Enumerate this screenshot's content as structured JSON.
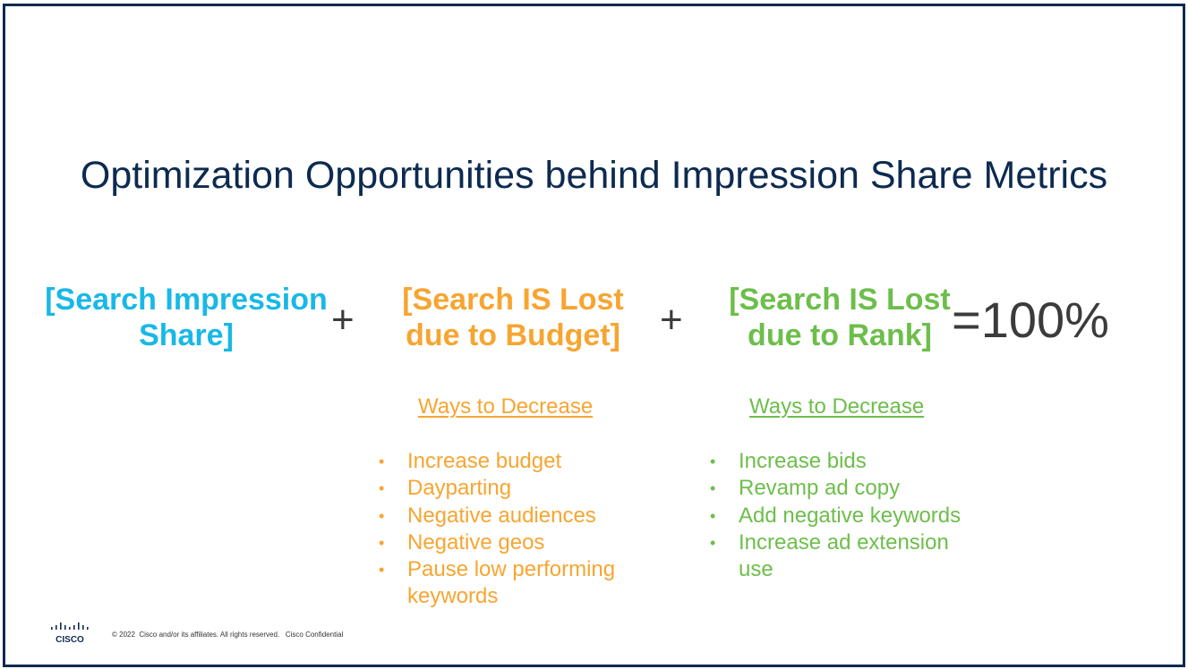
{
  "slide": {
    "title": "Optimization Opportunities behind Impression Share Metrics",
    "colors": {
      "frame": "#0d2a50",
      "title": "#0d2a50",
      "impression_share": "#19b8e6",
      "lost_budget": "#f7a531",
      "lost_rank": "#6dbe4b",
      "operators": "#3b3b3b"
    },
    "equation": {
      "term1": {
        "line1": "[Search Impression",
        "line2": "Share]"
      },
      "plus1": "+",
      "term2": {
        "line1": "[Search IS Lost",
        "line2": "due to Budget]"
      },
      "plus2": "+",
      "term3": {
        "line1": "[Search IS Lost",
        "line2": "due to Rank]"
      },
      "result": "=100%"
    },
    "budget_section": {
      "heading": "Ways to Decrease",
      "bullet_glyph": "•",
      "items": [
        "Increase budget",
        "Dayparting",
        "Negative audiences",
        "Negative geos",
        "Pause low performing keywords"
      ]
    },
    "rank_section": {
      "heading": "Ways to Decrease",
      "bullet_glyph": "•",
      "items": [
        "Increase bids",
        "Revamp ad copy",
        "Add negative keywords",
        "Increase ad extension use"
      ]
    },
    "footer": {
      "logo_text": "CISCO",
      "copyright": "© 2022  Cisco and/or its affiliates. All rights reserved.   Cisco Confidential"
    }
  }
}
